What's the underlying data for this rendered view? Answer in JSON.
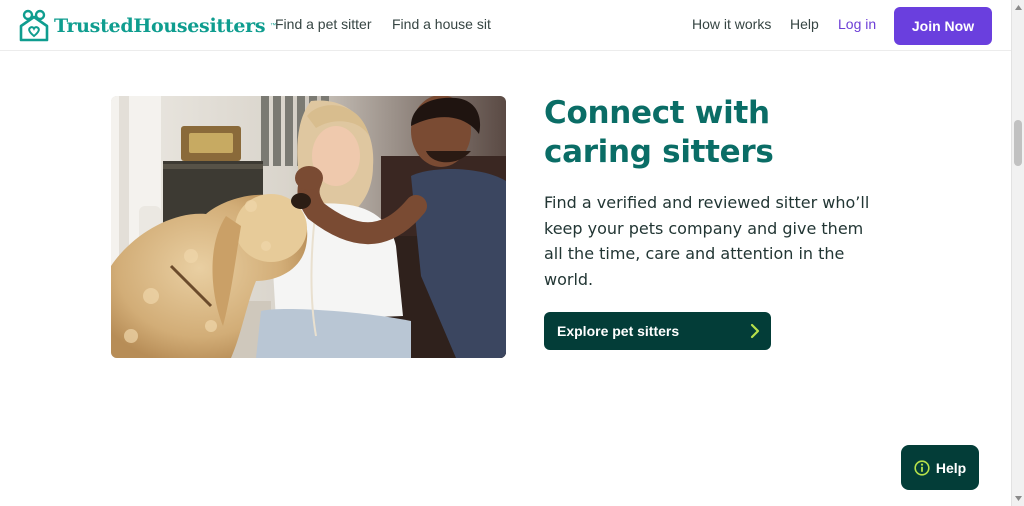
{
  "header": {
    "logo": {
      "text": "TrustedHousesitters",
      "tm": "™"
    },
    "nav_left": [
      {
        "label": "Find a pet sitter"
      },
      {
        "label": "Find a house sit"
      }
    ],
    "nav_right": {
      "how_it_works": "How it works",
      "help": "Help",
      "login": "Log in",
      "join": "Join Now"
    }
  },
  "hero": {
    "image_alt": "Woman and man petting a fluffy golden dog",
    "headline": "Connect with caring sitters",
    "body": "Find a verified and reviewed sitter who’ll keep your pets company and give them all the time, care and attention in the world.",
    "cta_label": "Explore pet sitters"
  },
  "help_widget": {
    "label": "Help",
    "icon": "info-icon"
  },
  "colors": {
    "brand_teal": "#0f9d8f",
    "headline_teal": "#0a6d66",
    "dark_green": "#033d38",
    "purple": "#6a3fde",
    "lime_accent": "#b6e04a"
  }
}
